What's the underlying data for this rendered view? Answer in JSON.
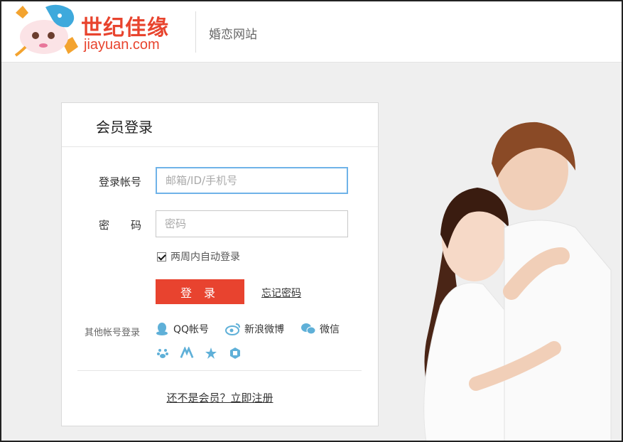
{
  "header": {
    "logo_cn": "世纪佳缘",
    "logo_en": "jiayuan.com",
    "subtitle": "婚恋网站"
  },
  "login": {
    "title": "会员登录",
    "account_label": "登录帐号",
    "account_placeholder": "邮箱/ID/手机号",
    "password_label": "密　　码",
    "password_placeholder": "密码",
    "remember_label": "两周内自动登录",
    "remember_checked": true,
    "login_button": "登 录",
    "forgot_link": "忘记密码",
    "other_label": "其他帐号登录",
    "social": [
      {
        "icon": "qq-icon",
        "label": "QQ帐号"
      },
      {
        "icon": "weibo-icon",
        "label": "新浪微博"
      },
      {
        "icon": "wechat-icon",
        "label": "微信"
      }
    ],
    "small_social_icons": [
      "baidu-icon",
      "renren-icon",
      "star-icon",
      "misc-icon"
    ],
    "register_link": "还不是会员？立即注册"
  },
  "colors": {
    "accent": "#e8432f",
    "focus_border": "#6fb3e8",
    "social_icon": "#5fb0d8"
  }
}
